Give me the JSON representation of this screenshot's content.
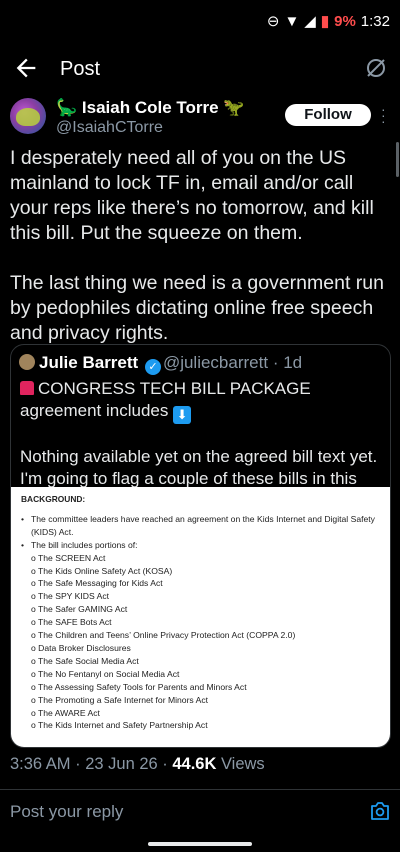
{
  "status_bar": {
    "battery": "9%",
    "time": "1:32"
  },
  "header": {
    "title": "Post"
  },
  "post": {
    "author_name": "Isaiah Cole Torre",
    "author_name_emoji_left": "🦕",
    "author_name_emoji_right": "🦖",
    "author_handle": "@IsaiahCTorre",
    "follow_label": "Follow",
    "paragraphs": [
      "I desperately need all of you on the US mainland to lock TF in, email and/or call your reps like there’s no tomorrow, and kill this bill. Put the squeeze on them.",
      "The last thing we need is a government run by pedophiles dictating online free speech and privacy rights."
    ],
    "timestamp": "3:36 AM · 23 Jun 26 · ",
    "views_count": "44.6K",
    "views_label": " Views"
  },
  "quote": {
    "author_name": "Julie Barrett",
    "author_handle": "@juliecbarrett",
    "age": "· 1d",
    "line1": "CONGRESS TECH BILL PACKAGE agreement includes",
    "line2": "Nothing available yet on the agreed bill text yet. I'm going to flag a couple of these bills in this th...",
    "image": {
      "heading": "BACKGROUND:",
      "bullets": [
        "The committee leaders have reached an agreement on the Kids Internet and Digital Safety (KIDS) Act.",
        "The bill includes portions of:"
      ],
      "acts": [
        "The SCREEN Act",
        "The Kids Online Safety Act (KOSA)",
        "The Safe Messaging for Kids Act",
        "The SPY KIDS Act",
        "The Safer GAMING Act",
        "The SAFE Bots Act",
        "The Children and Teens’ Online Privacy Protection Act (COPPA 2.0)",
        "Data Broker Disclosures",
        "The Safe Social Media Act",
        "The No Fentanyl on Social Media Act",
        "The Assessing Safety Tools for Parents and Minors Act",
        "The Promoting a Safe Internet for Minors Act",
        "The AWARE Act",
        "The Kids Internet and Safety Partnership Act"
      ]
    }
  },
  "reply": {
    "placeholder": "Post your reply"
  }
}
